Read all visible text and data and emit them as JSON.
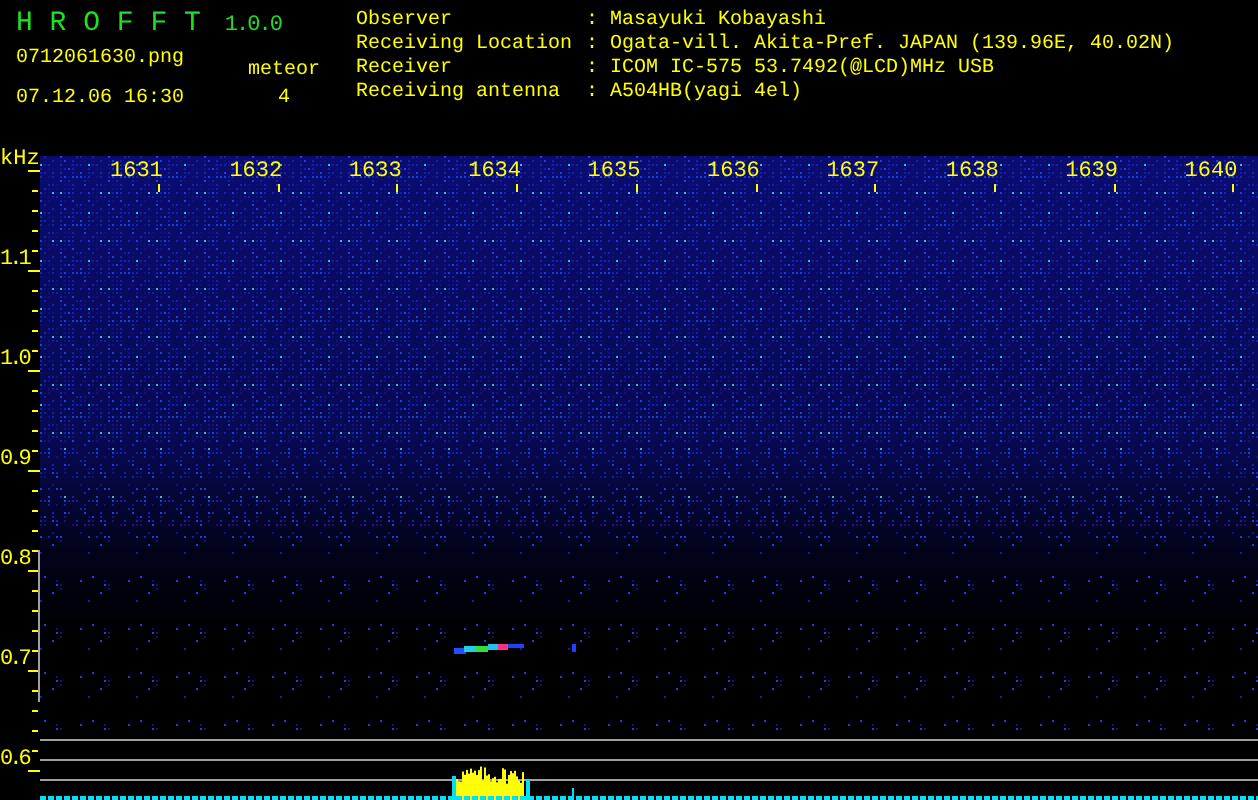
{
  "app": {
    "name": "H R O F F T",
    "version": "1.0.0"
  },
  "file": {
    "name": "0712061630.png",
    "datetime": "07.12.06 16:30"
  },
  "meteor": {
    "label": "meteor",
    "count": "4"
  },
  "info_separator": ":",
  "info": [
    {
      "label": "Observer",
      "value": "Masayuki Kobayashi"
    },
    {
      "label": "Receiving Location",
      "value": "Ogata-vill. Akita-Pref. JAPAN (139.96E, 40.02N)"
    },
    {
      "label": "Receiver",
      "value": "ICOM IC-575 53.7492(@LCD)MHz USB"
    },
    {
      "label": "Receiving antenna",
      "value": "A504HB(yagi 4el)"
    }
  ],
  "spectrogram": {
    "y_unit": "kHz",
    "y_labels": [
      "1.1",
      "1.0",
      "0.9",
      "0.8",
      "0.7",
      "0.6"
    ],
    "x_labels": [
      "1631",
      "1632",
      "1633",
      "1634",
      "1635",
      "1636",
      "1637",
      "1638",
      "1639",
      "1640"
    ]
  }
}
